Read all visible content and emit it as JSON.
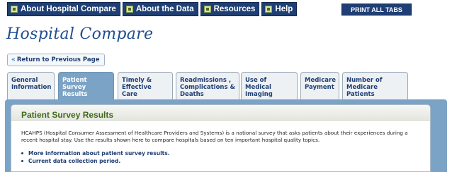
{
  "nav": {
    "items": [
      {
        "label": "About Hospital Compare",
        "icon": "page-icon"
      },
      {
        "label": "About the Data",
        "icon": "chart-icon"
      },
      {
        "label": "Resources",
        "icon": "list-icon"
      },
      {
        "label": "Help",
        "icon": "help-icon"
      }
    ],
    "print_all": "PRINT ALL TABS"
  },
  "page_title": "Hospital Compare",
  "return_link": "Return to Previous Page",
  "tabs": [
    {
      "line1": "General",
      "line2": "Information",
      "line3": ""
    },
    {
      "line1": "Patient Survey",
      "line2": "Results",
      "line3": ""
    },
    {
      "line1": "Timely &",
      "line2": "Effective Care",
      "line3": ""
    },
    {
      "line1": "Readmissions ,",
      "line2": "Complications &",
      "line3": "Deaths"
    },
    {
      "line1": "Use of Medical",
      "line2": "Imaging",
      "line3": ""
    },
    {
      "line1": "Medicare",
      "line2": "Payment",
      "line3": ""
    },
    {
      "line1": "Number of",
      "line2": "Medicare Patients",
      "line3": ""
    }
  ],
  "panel": {
    "title": "Patient Survey Results",
    "description": "HCAHPS (Hospital Consumer Assessment of Healthcare Providers and Systems) is a national survey that asks patients about their experiences during a recent hospital stay. Use the results shown here to compare hospitals based on ten important hospital quality topics.",
    "links": [
      "More information about patient survey results.",
      "Current data collection period."
    ]
  },
  "colors": {
    "nav_bg": "#1f3f74",
    "tab_active": "#7ba3c6",
    "title_blue": "#1f4f8f",
    "panel_title_green": "#3f6a1c"
  }
}
